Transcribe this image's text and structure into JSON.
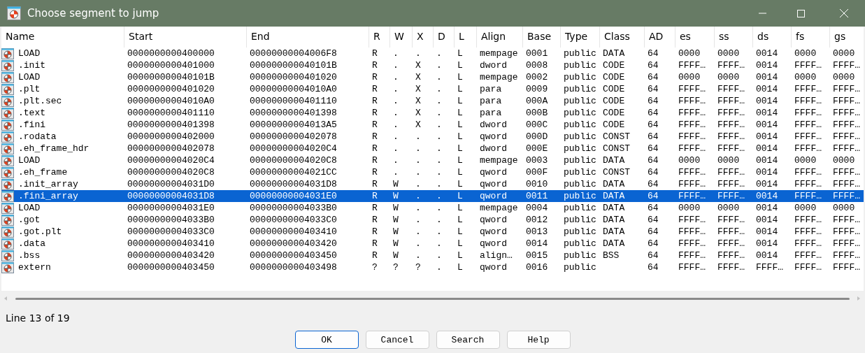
{
  "window": {
    "title": "Choose segment to jump"
  },
  "table": {
    "columns": [
      "Name",
      "Start",
      "End",
      "R",
      "W",
      "X",
      "D",
      "L",
      "Align",
      "Base",
      "Type",
      "Class",
      "AD",
      "es",
      "ss",
      "ds",
      "fs",
      "gs"
    ],
    "rows": [
      {
        "selected": false,
        "cells": [
          "LOAD",
          "0000000000400000",
          "00000000004006F8",
          "R",
          ".",
          ".",
          ".",
          "L",
          "mempage",
          "0001",
          "public",
          "DATA",
          "64",
          "0000",
          "0000",
          "0014",
          "0000",
          "0000"
        ]
      },
      {
        "selected": false,
        "cells": [
          ".init",
          "0000000000401000",
          "000000000040101B",
          "R",
          ".",
          "X",
          ".",
          "L",
          "dword",
          "0008",
          "public",
          "CODE",
          "64",
          "FFFF…",
          "FFFF…",
          "0014",
          "FFFF…",
          "FFFF…"
        ]
      },
      {
        "selected": false,
        "cells": [
          "LOAD",
          "000000000040101B",
          "0000000000401020",
          "R",
          ".",
          "X",
          ".",
          "L",
          "mempage",
          "0002",
          "public",
          "CODE",
          "64",
          "0000",
          "0000",
          "0014",
          "0000",
          "0000"
        ]
      },
      {
        "selected": false,
        "cells": [
          ".plt",
          "0000000000401020",
          "00000000004010A0",
          "R",
          ".",
          "X",
          ".",
          "L",
          "para",
          "0009",
          "public",
          "CODE",
          "64",
          "FFFF…",
          "FFFF…",
          "0014",
          "FFFF…",
          "FFFF…"
        ]
      },
      {
        "selected": false,
        "cells": [
          ".plt.sec",
          "00000000004010A0",
          "0000000000401110",
          "R",
          ".",
          "X",
          ".",
          "L",
          "para",
          "000A",
          "public",
          "CODE",
          "64",
          "FFFF…",
          "FFFF…",
          "0014",
          "FFFF…",
          "FFFF…"
        ]
      },
      {
        "selected": false,
        "cells": [
          ".text",
          "0000000000401110",
          "0000000000401398",
          "R",
          ".",
          "X",
          ".",
          "L",
          "para",
          "000B",
          "public",
          "CODE",
          "64",
          "FFFF…",
          "FFFF…",
          "0014",
          "FFFF…",
          "FFFF…"
        ]
      },
      {
        "selected": false,
        "cells": [
          ".fini",
          "0000000000401398",
          "00000000004013A5",
          "R",
          ".",
          "X",
          ".",
          "L",
          "dword",
          "000C",
          "public",
          "CODE",
          "64",
          "FFFF…",
          "FFFF…",
          "0014",
          "FFFF…",
          "FFFF…"
        ]
      },
      {
        "selected": false,
        "cells": [
          ".rodata",
          "0000000000402000",
          "0000000000402078",
          "R",
          ".",
          ".",
          ".",
          "L",
          "qword",
          "000D",
          "public",
          "CONST",
          "64",
          "FFFF…",
          "FFFF…",
          "0014",
          "FFFF…",
          "FFFF…"
        ]
      },
      {
        "selected": false,
        "cells": [
          ".eh_frame_hdr",
          "0000000000402078",
          "00000000004020C4",
          "R",
          ".",
          ".",
          ".",
          "L",
          "dword",
          "000E",
          "public",
          "CONST",
          "64",
          "FFFF…",
          "FFFF…",
          "0014",
          "FFFF…",
          "FFFF…"
        ]
      },
      {
        "selected": false,
        "cells": [
          "LOAD",
          "00000000004020C4",
          "00000000004020C8",
          "R",
          ".",
          ".",
          ".",
          "L",
          "mempage",
          "0003",
          "public",
          "DATA",
          "64",
          "0000",
          "0000",
          "0014",
          "0000",
          "0000"
        ]
      },
      {
        "selected": false,
        "cells": [
          ".eh_frame",
          "00000000004020C8",
          "00000000004021CC",
          "R",
          ".",
          ".",
          ".",
          "L",
          "qword",
          "000F",
          "public",
          "CONST",
          "64",
          "FFFF…",
          "FFFF…",
          "0014",
          "FFFF…",
          "FFFF…"
        ]
      },
      {
        "selected": false,
        "cells": [
          ".init_array",
          "00000000004031D0",
          "00000000004031D8",
          "R",
          "W",
          ".",
          ".",
          "L",
          "qword",
          "0010",
          "public",
          "DATA",
          "64",
          "FFFF…",
          "FFFF…",
          "0014",
          "FFFF…",
          "FFFF…"
        ]
      },
      {
        "selected": true,
        "cells": [
          ".fini_array",
          "00000000004031D8",
          "00000000004031E0",
          "R",
          "W",
          ".",
          ".",
          "L",
          "qword",
          "0011",
          "public",
          "DATA",
          "64",
          "FFFF…",
          "FFFF…",
          "0014",
          "FFFF…",
          "FFFF…"
        ]
      },
      {
        "selected": false,
        "cells": [
          "LOAD",
          "00000000004031E0",
          "00000000004033B0",
          "R",
          "W",
          ".",
          ".",
          "L",
          "mempage",
          "0004",
          "public",
          "DATA",
          "64",
          "0000",
          "0000",
          "0014",
          "0000",
          "0000"
        ]
      },
      {
        "selected": false,
        "cells": [
          ".got",
          "00000000004033B0",
          "00000000004033C0",
          "R",
          "W",
          ".",
          ".",
          "L",
          "qword",
          "0012",
          "public",
          "DATA",
          "64",
          "FFFF…",
          "FFFF…",
          "0014",
          "FFFF…",
          "FFFF…"
        ]
      },
      {
        "selected": false,
        "cells": [
          ".got.plt",
          "00000000004033C0",
          "0000000000403410",
          "R",
          "W",
          ".",
          ".",
          "L",
          "qword",
          "0013",
          "public",
          "DATA",
          "64",
          "FFFF…",
          "FFFF…",
          "0014",
          "FFFF…",
          "FFFF…"
        ]
      },
      {
        "selected": false,
        "cells": [
          ".data",
          "0000000000403410",
          "0000000000403420",
          "R",
          "W",
          ".",
          ".",
          "L",
          "qword",
          "0014",
          "public",
          "DATA",
          "64",
          "FFFF…",
          "FFFF…",
          "0014",
          "FFFF…",
          "FFFF…"
        ]
      },
      {
        "selected": false,
        "cells": [
          ".bss",
          "0000000000403420",
          "0000000000403450",
          "R",
          "W",
          ".",
          ".",
          "L",
          "align…",
          "0015",
          "public",
          "BSS",
          "64",
          "FFFF…",
          "FFFF…",
          "0014",
          "FFFF…",
          "FFFF…"
        ]
      },
      {
        "selected": false,
        "cells": [
          "extern",
          "0000000000403450",
          "0000000000403498",
          "?",
          "?",
          "?",
          ".",
          "L",
          "qword",
          "0016",
          "public",
          "",
          "64",
          "FFFF…",
          "FFFF…",
          "FFFF…",
          "FFFF…",
          "FFFF…"
        ]
      }
    ]
  },
  "status_bar": "Line 13 of 19",
  "buttons": [
    {
      "label": "OK",
      "default": true
    },
    {
      "label": "Cancel",
      "default": false
    },
    {
      "label": "Search",
      "default": false
    },
    {
      "label": "Help",
      "default": false
    }
  ]
}
